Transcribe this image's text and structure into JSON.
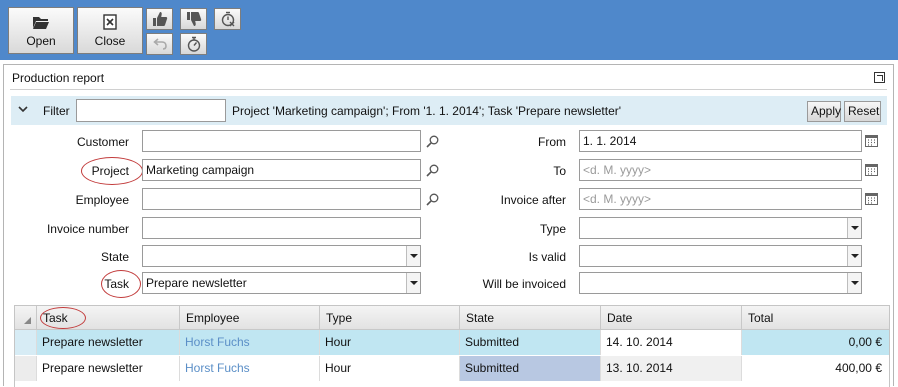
{
  "toolbar": {
    "open_label": "Open",
    "close_label": "Close",
    "icons": [
      "folder-open-icon",
      "close-document-icon",
      "thumbs-up-icon",
      "thumbs-down-icon",
      "timer-cancel-icon",
      "undo-icon",
      "stopwatch-icon"
    ]
  },
  "panel": {
    "title": "Production report"
  },
  "filter": {
    "label": "Filter",
    "quick_value": "",
    "summary": "Project 'Marketing campaign'; From '1. 1. 2014'; Task 'Prepare newsletter'",
    "apply_label": "Apply",
    "reset_label": "Reset"
  },
  "form": {
    "customer": {
      "label": "Customer",
      "value": ""
    },
    "project": {
      "label": "Project",
      "value": "Marketing campaign"
    },
    "employee": {
      "label": "Employee",
      "value": ""
    },
    "invoice_number": {
      "label": "Invoice number",
      "value": ""
    },
    "state": {
      "label": "State",
      "value": ""
    },
    "task": {
      "label": "Task",
      "value": "Prepare newsletter"
    },
    "from": {
      "label": "From",
      "value": "1. 1. 2014"
    },
    "to": {
      "label": "To",
      "placeholder": "<d. M. yyyy>"
    },
    "invoice_after": {
      "label": "Invoice after",
      "placeholder": "<d. M. yyyy>"
    },
    "type": {
      "label": "Type",
      "value": ""
    },
    "is_valid": {
      "label": "Is valid",
      "value": ""
    },
    "will_be_invoiced": {
      "label": "Will be invoiced",
      "value": ""
    }
  },
  "grid": {
    "columns": [
      "Task",
      "Employee",
      "Type",
      "State",
      "Date",
      "Total"
    ],
    "rows": [
      {
        "task": "Prepare newsletter",
        "employee": "Horst Fuchs",
        "type": "Hour",
        "state": "Submitted",
        "date": "14. 10. 2014",
        "total": "0,00 €"
      },
      {
        "task": "Prepare newsletter",
        "employee": "Horst Fuchs",
        "type": "Hour",
        "state": "Submitted",
        "date": "13. 10. 2014",
        "total": "400,00 €"
      }
    ]
  },
  "colors": {
    "toolbar_bg": "#4f88cb",
    "filter_bg": "#ddedf5",
    "row_selected": "#c0e6f2",
    "link": "#5b8fc7",
    "annotation": "#c23b3b"
  }
}
